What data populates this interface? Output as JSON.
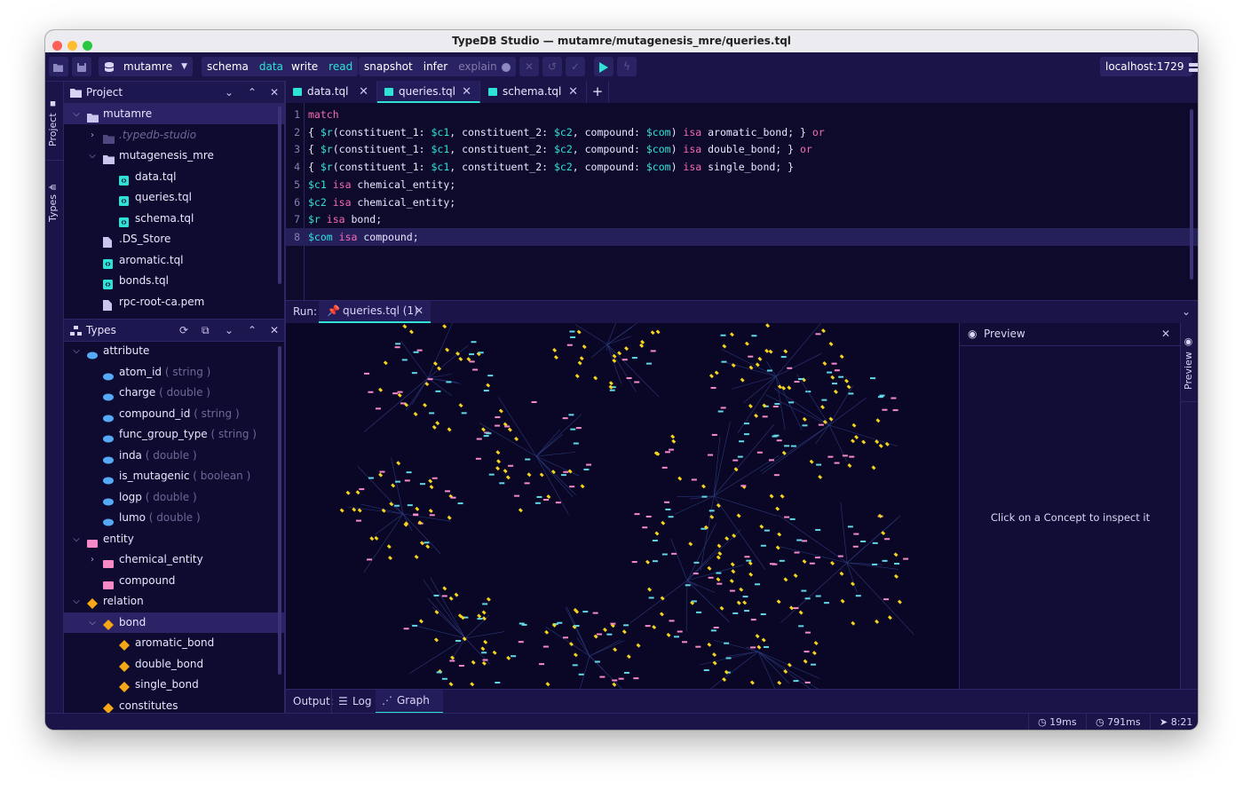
{
  "window": {
    "title": "TypeDB Studio — mutamre/mutagenesis_mre/queries.tql"
  },
  "toolbar": {
    "database": "mutamre",
    "session_schema": "schema",
    "session_data": "data",
    "tx_write": "write",
    "tx_read": "read",
    "opt_snapshot": "snapshot",
    "opt_infer": "infer",
    "opt_explain": "explain",
    "server": "localhost:1729"
  },
  "rail": {
    "project": "Project",
    "types": "Types"
  },
  "project": {
    "title": "Project",
    "items": [
      {
        "label": "mutamre",
        "depth": 0,
        "kind": "folder",
        "open": true,
        "sel": true
      },
      {
        "label": ".typedb-studio",
        "depth": 1,
        "kind": "folder",
        "open": false,
        "faded": true
      },
      {
        "label": "mutagenesis_mre",
        "depth": 1,
        "kind": "folder",
        "open": true
      },
      {
        "label": "data.tql",
        "depth": 2,
        "kind": "tql"
      },
      {
        "label": "queries.tql",
        "depth": 2,
        "kind": "tql"
      },
      {
        "label": "schema.tql",
        "depth": 2,
        "kind": "tql"
      },
      {
        "label": ".DS_Store",
        "depth": 1,
        "kind": "file"
      },
      {
        "label": "aromatic.tql",
        "depth": 1,
        "kind": "tql"
      },
      {
        "label": "bonds.tql",
        "depth": 1,
        "kind": "tql"
      },
      {
        "label": "rpc-root-ca.pem",
        "depth": 1,
        "kind": "file"
      }
    ]
  },
  "types": {
    "title": "Types",
    "items": [
      {
        "label": "attribute",
        "hint": "",
        "depth": 0,
        "kind": "attr",
        "open": true
      },
      {
        "label": "atom_id",
        "hint": " ( string )",
        "depth": 1,
        "kind": "attr"
      },
      {
        "label": "charge",
        "hint": " ( double )",
        "depth": 1,
        "kind": "attr"
      },
      {
        "label": "compound_id",
        "hint": " ( string )",
        "depth": 1,
        "kind": "attr"
      },
      {
        "label": "func_group_type",
        "hint": " ( string )",
        "depth": 1,
        "kind": "attr"
      },
      {
        "label": "inda",
        "hint": " ( double )",
        "depth": 1,
        "kind": "attr"
      },
      {
        "label": "is_mutagenic",
        "hint": " ( boolean )",
        "depth": 1,
        "kind": "attr"
      },
      {
        "label": "logp",
        "hint": " ( double )",
        "depth": 1,
        "kind": "attr"
      },
      {
        "label": "lumo",
        "hint": " ( double )",
        "depth": 1,
        "kind": "attr"
      },
      {
        "label": "entity",
        "hint": "",
        "depth": 0,
        "kind": "entity",
        "open": true
      },
      {
        "label": "chemical_entity",
        "hint": "",
        "depth": 1,
        "kind": "entity",
        "open": false
      },
      {
        "label": "compound",
        "hint": "",
        "depth": 1,
        "kind": "entity"
      },
      {
        "label": "relation",
        "hint": "",
        "depth": 0,
        "kind": "relation",
        "open": true
      },
      {
        "label": "bond",
        "hint": "",
        "depth": 1,
        "kind": "relation",
        "open": true,
        "sel": true
      },
      {
        "label": "aromatic_bond",
        "hint": "",
        "depth": 2,
        "kind": "relation"
      },
      {
        "label": "double_bond",
        "hint": "",
        "depth": 2,
        "kind": "relation"
      },
      {
        "label": "single_bond",
        "hint": "",
        "depth": 2,
        "kind": "relation"
      },
      {
        "label": "constitutes",
        "hint": "",
        "depth": 1,
        "kind": "relation"
      }
    ]
  },
  "tabs": [
    {
      "label": "data.tql",
      "active": false
    },
    {
      "label": "queries.tql",
      "active": true
    },
    {
      "label": "schema.tql",
      "active": false
    }
  ],
  "editor": {
    "current_line": 8,
    "lines": [
      "<k>match</k>",
      "{ <v>$r</v>(constituent_1: <v>$c1</v>, constituent_2: <v>$c2</v>, compound: <v>$com</v>) <k>isa</k> aromatic_bond; } <k>or</k>",
      "{ <v>$r</v>(constituent_1: <v>$c1</v>, constituent_2: <v>$c2</v>, compound: <v>$com</v>) <k>isa</k> double_bond; } <k>or</k>",
      "{ <v>$r</v>(constituent_1: <v>$c1</v>, constituent_2: <v>$c2</v>, compound: <v>$com</v>) <k>isa</k> single_bond; }",
      "<v>$c1</v> <k>isa</k> chemical_entity;",
      "<v>$c2</v> <k>isa</k> chemical_entity;",
      "<v>$r</v> <k>isa</k> bond;",
      "<v>$com</v> <k>isa</k> compound;"
    ]
  },
  "run": {
    "label": "Run:",
    "tab": "queries.tql (1)"
  },
  "preview": {
    "title": "Preview",
    "rail_label": "Preview",
    "empty": "Click on a Concept to inspect it"
  },
  "output": {
    "label": "Output:",
    "log": "Log",
    "graph": "Graph (1)"
  },
  "status": {
    "t1": "19ms",
    "t2": "791ms",
    "cursor": "8:21"
  },
  "colors": {
    "accent": "#2ee3d5",
    "attribute": "#56a9f6",
    "entity": "#f68ac6",
    "relation": "#f6a716",
    "keyword": "#f66bb0",
    "background": "#0f0b30"
  }
}
